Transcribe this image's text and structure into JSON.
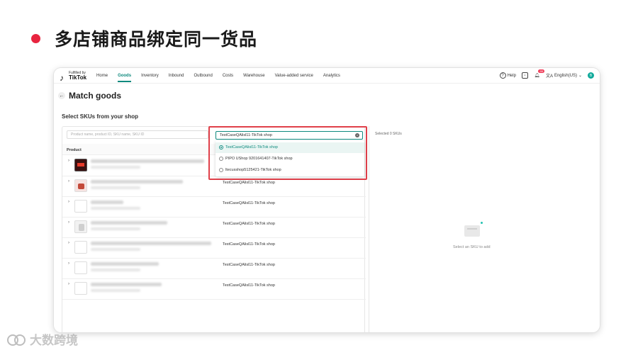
{
  "slide": {
    "title": "多店铺商品绑定同一货品",
    "watermark": "大数跨境"
  },
  "app": {
    "logo_top": "Fulfilled by",
    "logo_bottom": "TikTok",
    "nav": [
      {
        "label": "Home",
        "active": false
      },
      {
        "label": "Goods",
        "active": true
      },
      {
        "label": "Inventory",
        "active": false
      },
      {
        "label": "Inbound",
        "active": false
      },
      {
        "label": "Outbound",
        "active": false
      },
      {
        "label": "Costs",
        "active": false
      },
      {
        "label": "Warehouse",
        "active": false
      },
      {
        "label": "Value-added service",
        "active": false
      },
      {
        "label": "Analytics",
        "active": false
      }
    ],
    "help": "Help",
    "notification_count": "99",
    "language": "English(US)",
    "avatar_letter": "B"
  },
  "page": {
    "back_icon": "←",
    "title": "Match goods",
    "section_title": "Select SKUs from your shop",
    "search_placeholder": "Product name, product ID, SKU name, SKU ID",
    "column_product": "Product",
    "shop_select_value": "TestCaseQAlisl11-TikTok shop",
    "shop_options": [
      {
        "label": "TestCaseQAlisl11-TikTok shop",
        "selected": true
      },
      {
        "label": "PIPO UShop 9201641407-TikTok shop",
        "selected": false
      },
      {
        "label": "ltecusshop5125421-TikTok shop",
        "selected": false
      }
    ],
    "rows": [
      {
        "thumb": "img1",
        "shop": ""
      },
      {
        "thumb": "img2",
        "shop": "TestCaseQAlisl11-TikTok shop"
      },
      {
        "thumb": "plain",
        "shop": "TestCaseQAlisl11-TikTok shop"
      },
      {
        "thumb": "img3",
        "shop": "TestCaseQAlisl11-TikTok shop"
      },
      {
        "thumb": "plain",
        "shop": "TestCaseQAlisl11-TikTok shop"
      },
      {
        "thumb": "plain",
        "shop": "TestCaseQAlisl11-TikTok shop"
      },
      {
        "thumb": "plain",
        "shop": "TestCaseQAlisl11-TikTok shop"
      }
    ],
    "selected_label": "Selected 0 SKUs",
    "empty_text": "Select an SKU to add"
  },
  "colors": {
    "accent": "#0e8a7e",
    "highlight_box": "#e0404a",
    "bullet": "#e8243f"
  }
}
